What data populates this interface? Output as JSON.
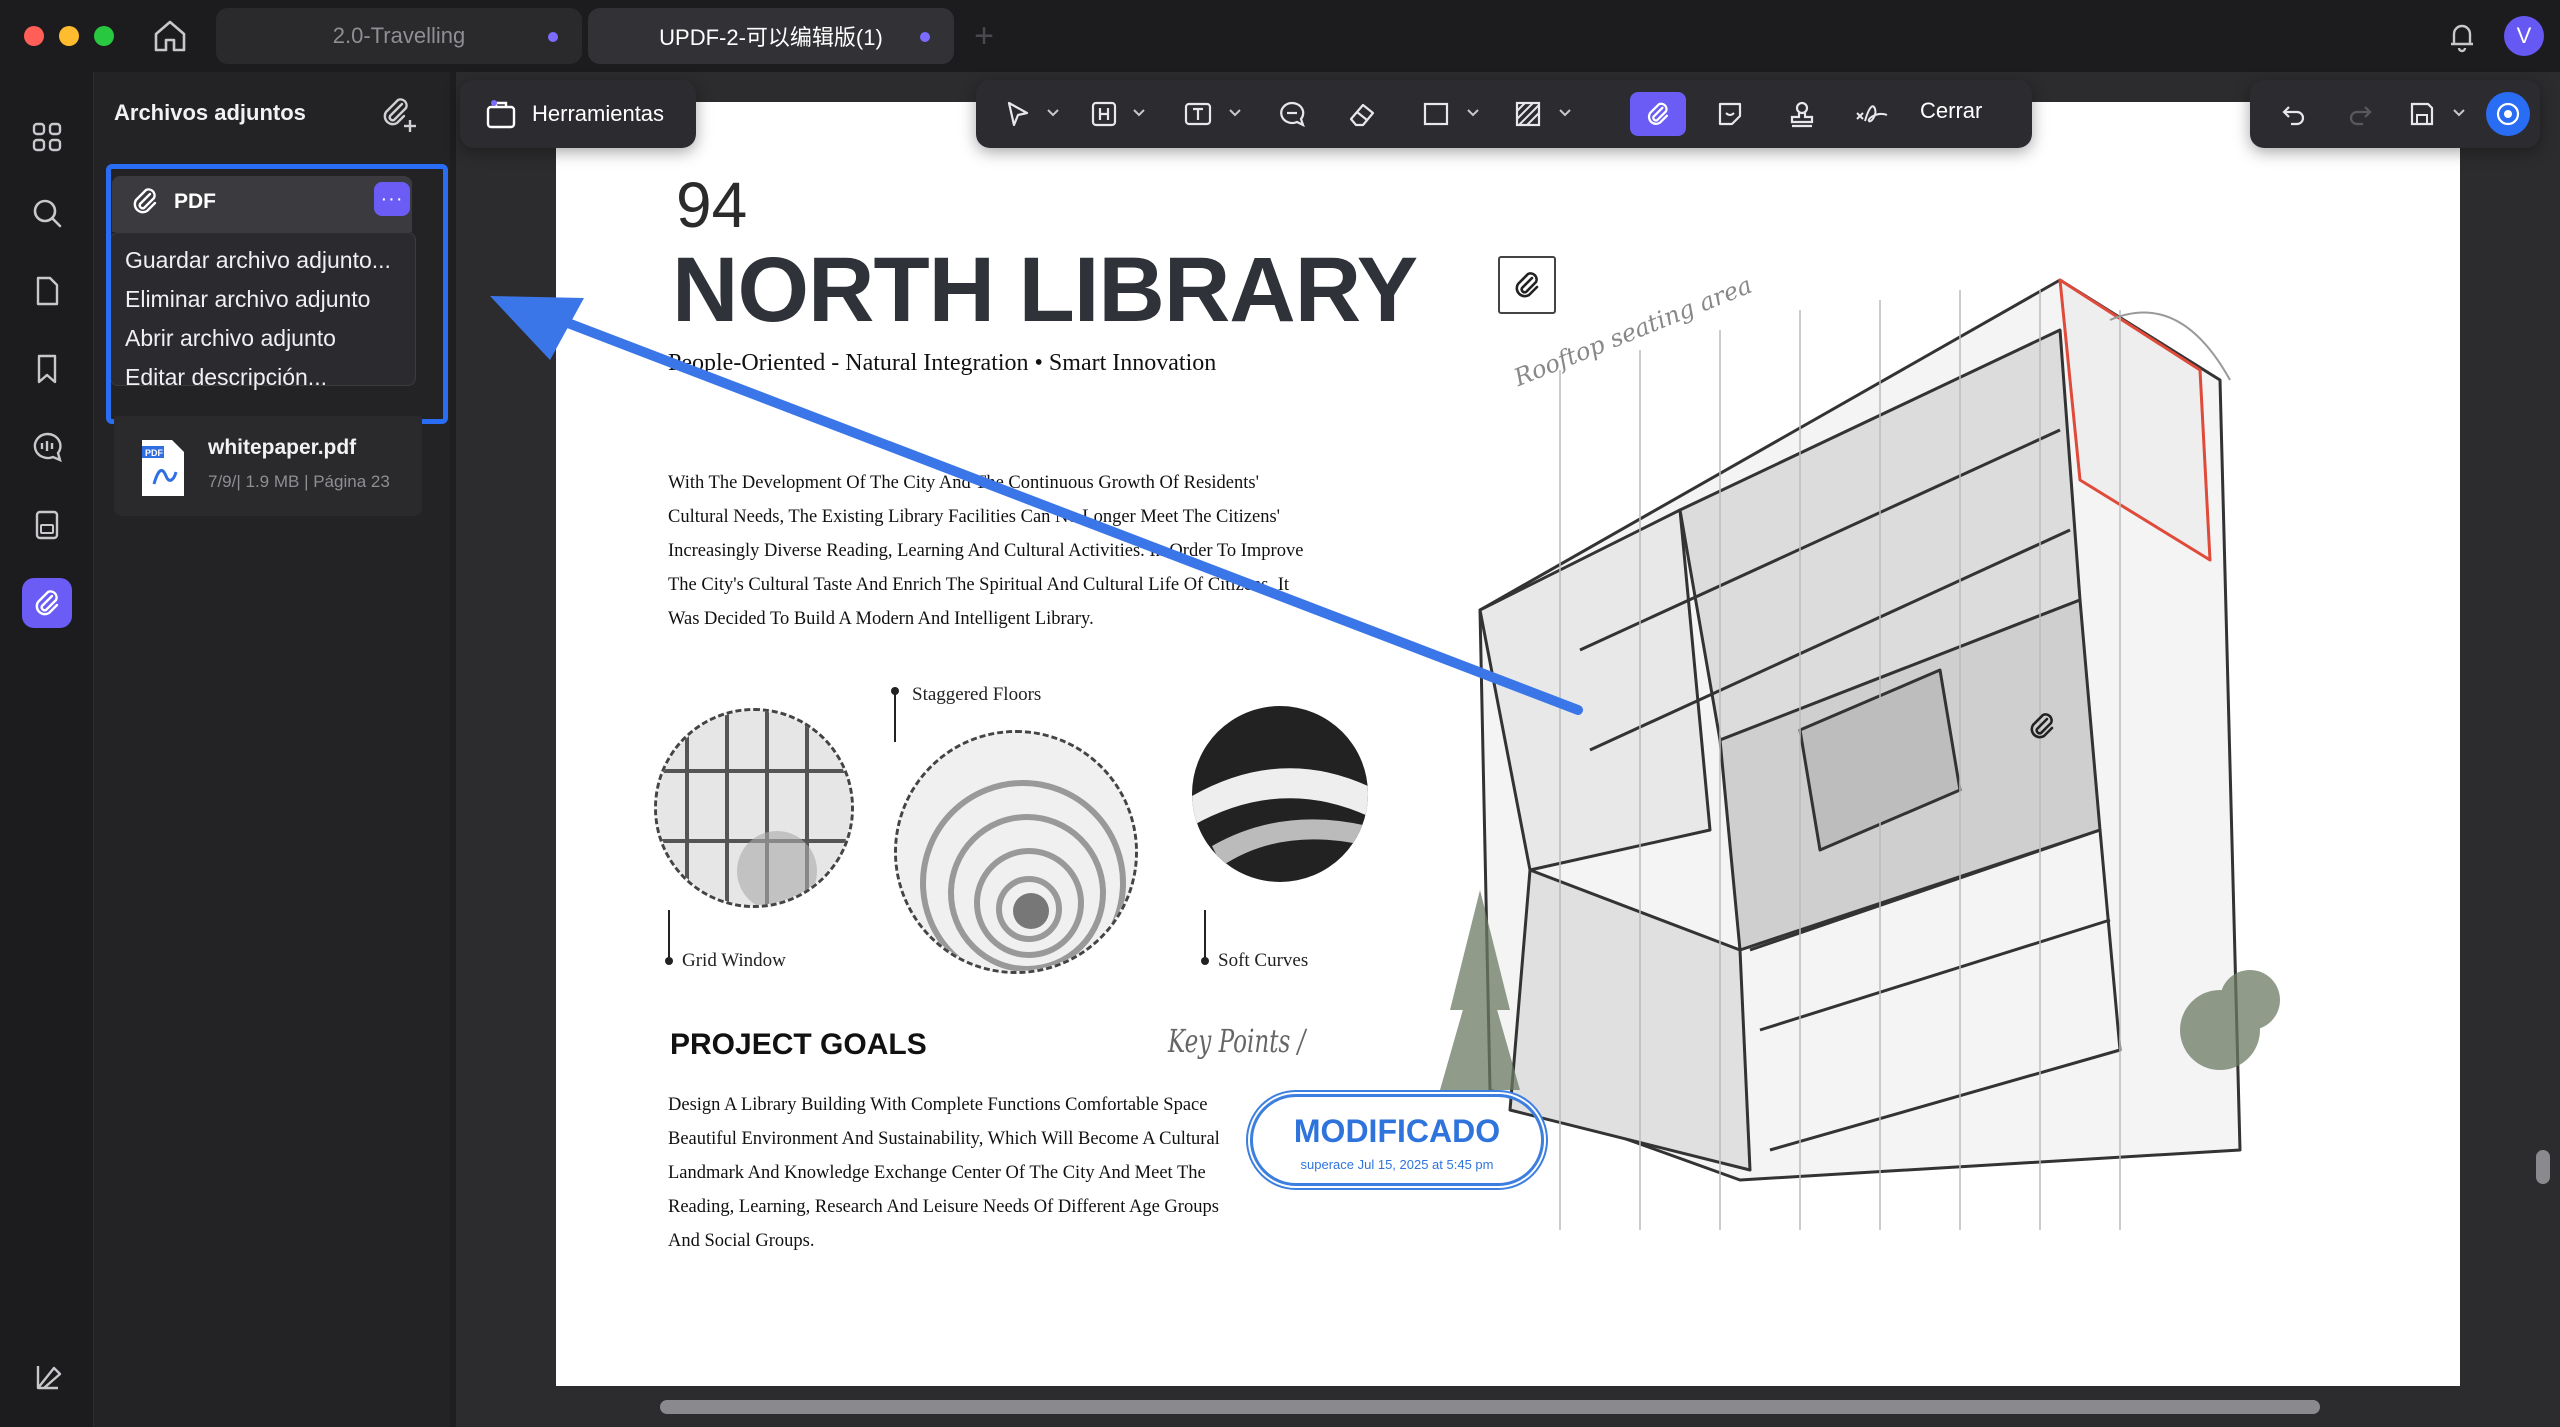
{
  "window": {
    "tabs": [
      {
        "label": "2.0-Travelling"
      },
      {
        "label": "UPDF-2-可以编辑版(1)"
      }
    ],
    "user_initial": "V"
  },
  "panel": {
    "title": "Archivos adjuntos",
    "attachment_header": "PDF",
    "more_label": "···",
    "menu": [
      {
        "label": "Guardar archivo adjunto..."
      },
      {
        "label": "Eliminar archivo adjunto"
      },
      {
        "label": "Abrir archivo adjunto"
      },
      {
        "label": "Editar descripción..."
      }
    ],
    "file": {
      "name": "whitepaper.pdf",
      "meta": "7/9/| 1.9 MB | Página 23",
      "icon_label": "PDF"
    }
  },
  "toolbar": {
    "tools_label": "Herramientas",
    "close_label": "Cerrar"
  },
  "document": {
    "number": "94",
    "title": "NORTH LIBRARY",
    "subtitle": "People-Oriented - Natural Integration • Smart Innovation",
    "body_lines": [
      "With The Development Of The City And The Continuous Growth Of Residents'",
      "Cultural Needs, The Existing Library Facilities Can No Longer Meet The Citizens'",
      "Increasingly Diverse Reading, Learning And Cultural Activities. In Order To Improve",
      "The City's Cultural Taste And Enrich The Spiritual And Cultural Life Of Citizens, It",
      "Was Decided To Build A Modern And Intelligent Library."
    ],
    "captions": {
      "staggered": "Staggered Floors",
      "grid": "Grid Window",
      "soft": "Soft Curves"
    },
    "rooftop_note": "Rooftop seating area",
    "goals_title": "PROJECT GOALS",
    "key_points": "Key Points /",
    "goals_lines": [
      "Design A Library Building With Complete Functions Comfortable Space",
      "Beautiful Environment And Sustainability, Which Will Become A Cultural",
      "Landmark And Knowledge Exchange Center Of The City And Meet The",
      "Reading, Learning, Research And Leisure Needs Of Different Age Groups",
      "And Social Groups."
    ],
    "stamp": {
      "title": "MODIFICADO",
      "sub": "superace Jul 15, 2025 at 5:45 pm"
    }
  },
  "colors": {
    "accent": "#6a5cf5",
    "highlight": "#2a6df5",
    "arrow": "#3b76e8",
    "stamp": "#2f74dd"
  },
  "icons": {
    "rail": [
      "grid-icon",
      "search-icon",
      "page-icon",
      "bookmark-icon",
      "comment-icon",
      "form-icon",
      "attachment-icon",
      "layers-icon"
    ],
    "toolbar": [
      "pointer-icon",
      "highlight-icon",
      "text-box-icon",
      "comment-icon",
      "eraser-icon",
      "rectangle-icon",
      "hatch-icon",
      "attachment-icon",
      "sticker-icon",
      "stamp-icon",
      "signature-icon"
    ]
  }
}
